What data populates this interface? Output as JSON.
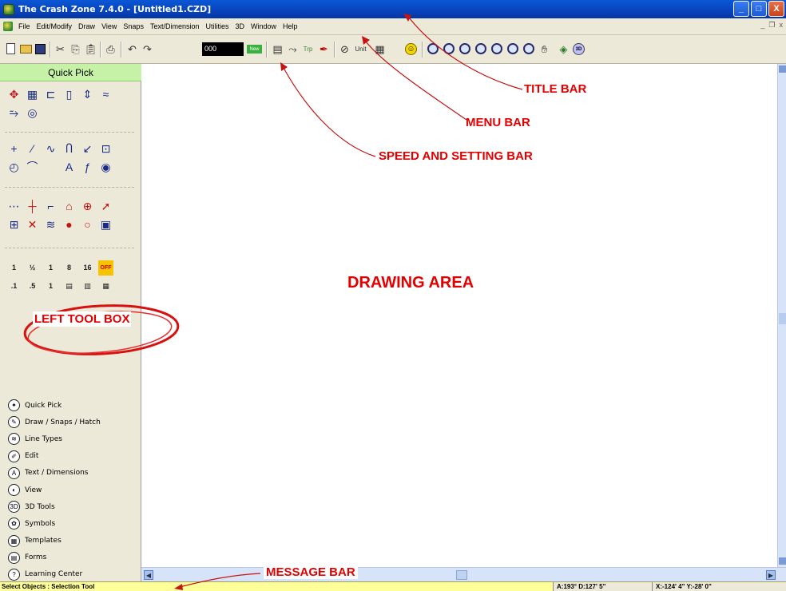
{
  "window": {
    "title": "The Crash Zone 7.4.0 - [Untitled1.CZD]",
    "buttons": {
      "minimize": "_",
      "maximize": "□",
      "close": "X"
    }
  },
  "menubar": {
    "items": [
      "File",
      "Edit/Modify",
      "Draw",
      "View",
      "Snaps",
      "Text/Dimension",
      "Utilities",
      "3D",
      "Window",
      "Help"
    ],
    "mdi_buttons": {
      "minimize": "_",
      "restore": "❐",
      "close": "x"
    }
  },
  "toolbar": {
    "lineweight_value": "000",
    "new_label": "New",
    "icons": [
      "new-document-icon",
      "open-folder-icon",
      "save-disk-icon",
      "cut-icon",
      "copy-icon",
      "paste-icon",
      "print-icon",
      "undo-icon",
      "redo-icon",
      "layer-icon",
      "snap-icon",
      "trap-icon",
      "magic-pen-icon",
      "units-icon",
      "grid-icon",
      "smiley-icon",
      "zoom-in-icon",
      "zoom-out-icon",
      "zoom-window-icon",
      "zoom-all-icon",
      "zoom-extents-icon",
      "zoom-previous-icon",
      "zoom-realtime-icon",
      "pan-hand-icon",
      "render-icon",
      "view-3d-icon"
    ]
  },
  "left_toolbox": {
    "header": "Quick Pick",
    "tool_rows": [
      [
        "✥",
        "▦",
        "⊏",
        "▯",
        "⇕",
        "≈"
      ],
      [
        "⥲",
        "◎"
      ],
      [
        "+",
        "⁄",
        "∿",
        "Ⴖ",
        "↙",
        "⊡"
      ],
      [
        "◴",
        "⌒",
        "",
        "A",
        "ƒ",
        "◉"
      ],
      [
        "⋯",
        "┼",
        "⌐",
        "⌂",
        "⊕",
        "➚"
      ],
      [
        "⊞",
        "✕",
        "≋",
        "●",
        "○",
        "▣"
      ],
      [
        "1",
        "½",
        "1",
        "8",
        "16",
        "OFF"
      ],
      [
        ".1",
        ".5",
        "1",
        "▤",
        "▥",
        "▦"
      ]
    ],
    "categories": [
      {
        "label": "Quick Pick",
        "icon": "quick-pick-icon",
        "glyph": "✦"
      },
      {
        "label": "Draw / Snaps / Hatch",
        "icon": "draw-icon",
        "glyph": "✎"
      },
      {
        "label": "Line Types",
        "icon": "line-types-icon",
        "glyph": "≋"
      },
      {
        "label": "Edit",
        "icon": "edit-icon",
        "glyph": "✐"
      },
      {
        "label": "Text / Dimensions",
        "icon": "text-icon",
        "glyph": "A"
      },
      {
        "label": "View",
        "icon": "view-icon",
        "glyph": "◐"
      },
      {
        "label": "3D Tools",
        "icon": "3d-tools-icon",
        "glyph": "3D"
      },
      {
        "label": "Symbols",
        "icon": "symbols-icon",
        "glyph": "✿"
      },
      {
        "label": "Templates",
        "icon": "templates-icon",
        "glyph": "▦"
      },
      {
        "label": "Forms",
        "icon": "forms-icon",
        "glyph": "▤"
      },
      {
        "label": "Learning Center",
        "icon": "learning-center-icon",
        "glyph": "?"
      }
    ]
  },
  "statusbar": {
    "message": "Select Objects : Selection Tool",
    "angle": "A:193°  D:127' 5\"",
    "coords": "X:-124' 4\"  Y:-28' 0\""
  },
  "annotations": {
    "title_bar": "TITLE BAR",
    "menu_bar": "MENU BAR",
    "speed_bar": "SPEED AND SETTING BAR",
    "drawing_area": "DRAWING AREA",
    "left_tool_box": "LEFT TOOL BOX",
    "message_bar": "MESSAGE BAR"
  },
  "colors": {
    "title_bar": "#0a57d6",
    "quick_pick_header": "#c6f2a8",
    "status_bar": "#ffff99",
    "annotation": "#e30000"
  }
}
